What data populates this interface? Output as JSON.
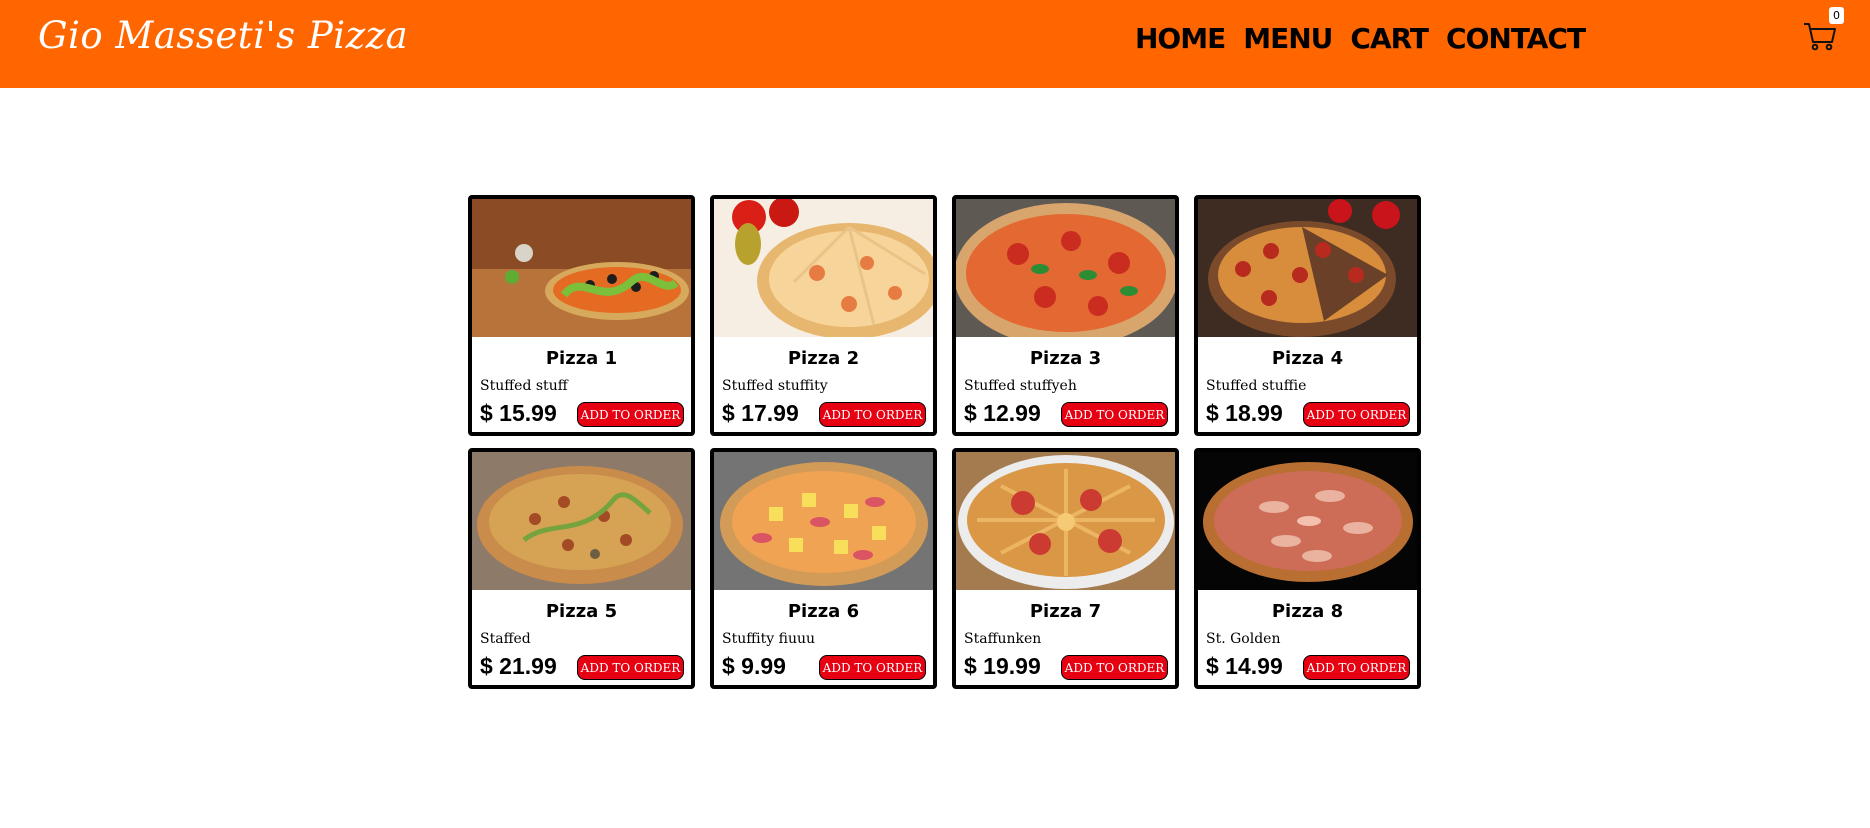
{
  "site": {
    "brand": "Gio Masseti's Pizza",
    "nav": [
      {
        "label": "HOME"
      },
      {
        "label": "MENU"
      },
      {
        "label": "CART"
      },
      {
        "label": "CONTACT"
      }
    ],
    "cart_count": "0"
  },
  "colors": {
    "header": "#ff6600",
    "button": "#e60012",
    "card_border": "#000000"
  },
  "menu": {
    "add_label": "ADD TO ORDER",
    "items": [
      {
        "name": "Pizza 1",
        "description": "Stuffed stuff",
        "price": "$ 15.99"
      },
      {
        "name": "Pizza 2",
        "description": "Stuffed stuffity",
        "price": "$ 17.99"
      },
      {
        "name": "Pizza 3",
        "description": "Stuffed stuffyeh",
        "price": "$ 12.99"
      },
      {
        "name": "Pizza 4",
        "description": "Stuffed stuffie",
        "price": "$ 18.99"
      },
      {
        "name": "Pizza 5",
        "description": "Staffed",
        "price": "$ 21.99"
      },
      {
        "name": "Pizza 6",
        "description": "Stuffity fiuuu",
        "price": "$ 9.99"
      },
      {
        "name": "Pizza 7",
        "description": "Staffunken",
        "price": "$ 19.99"
      },
      {
        "name": "Pizza 8",
        "description": "St. Golden",
        "price": "$ 14.99"
      }
    ]
  },
  "icons": {
    "cart": "shopping-cart-icon",
    "pizza_photo": "pizza-photo"
  }
}
